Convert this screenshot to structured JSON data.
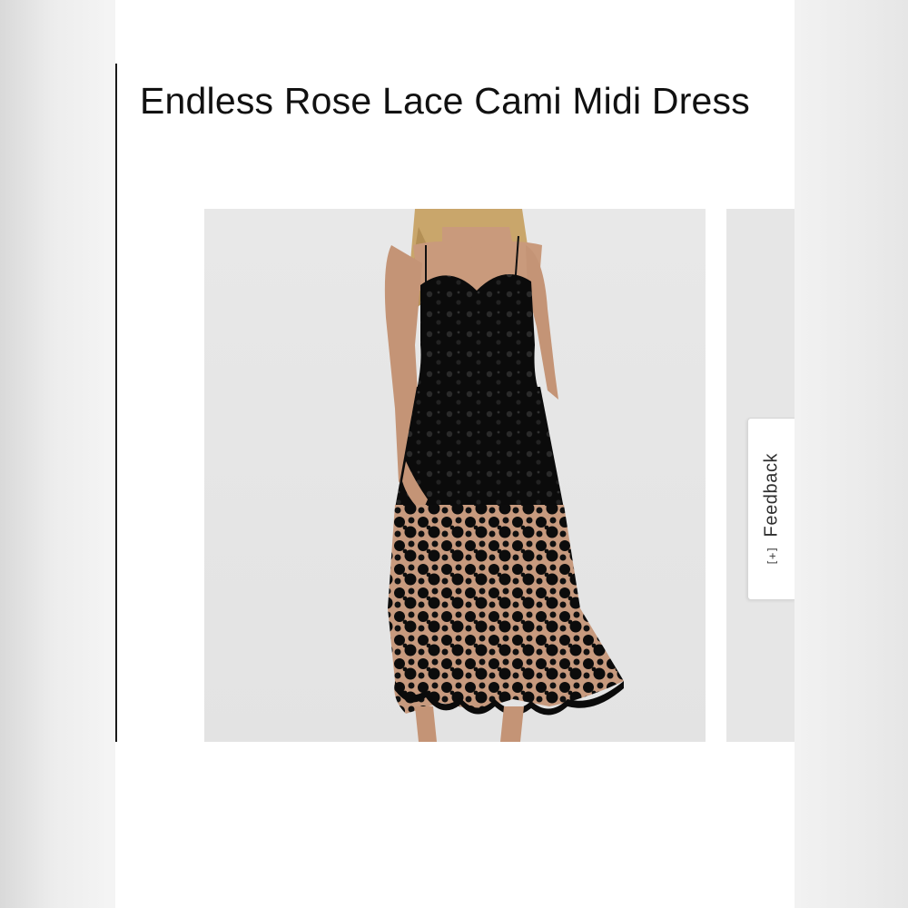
{
  "product": {
    "title": "Endless Rose Lace Cami Midi Dress"
  },
  "gallery": {
    "main_image": "model-wearing-black-lace-cami-midi-dress",
    "next_image_peek": "next-product-photo"
  },
  "feedback": {
    "icon": "[+]",
    "label": "Feedback"
  },
  "colors": {
    "page_background": "#ffffff",
    "photo_background": "#e5e5e5",
    "dress": "#0d0d0d",
    "skin": "#c99a7c",
    "hair": "#c8a56a"
  }
}
